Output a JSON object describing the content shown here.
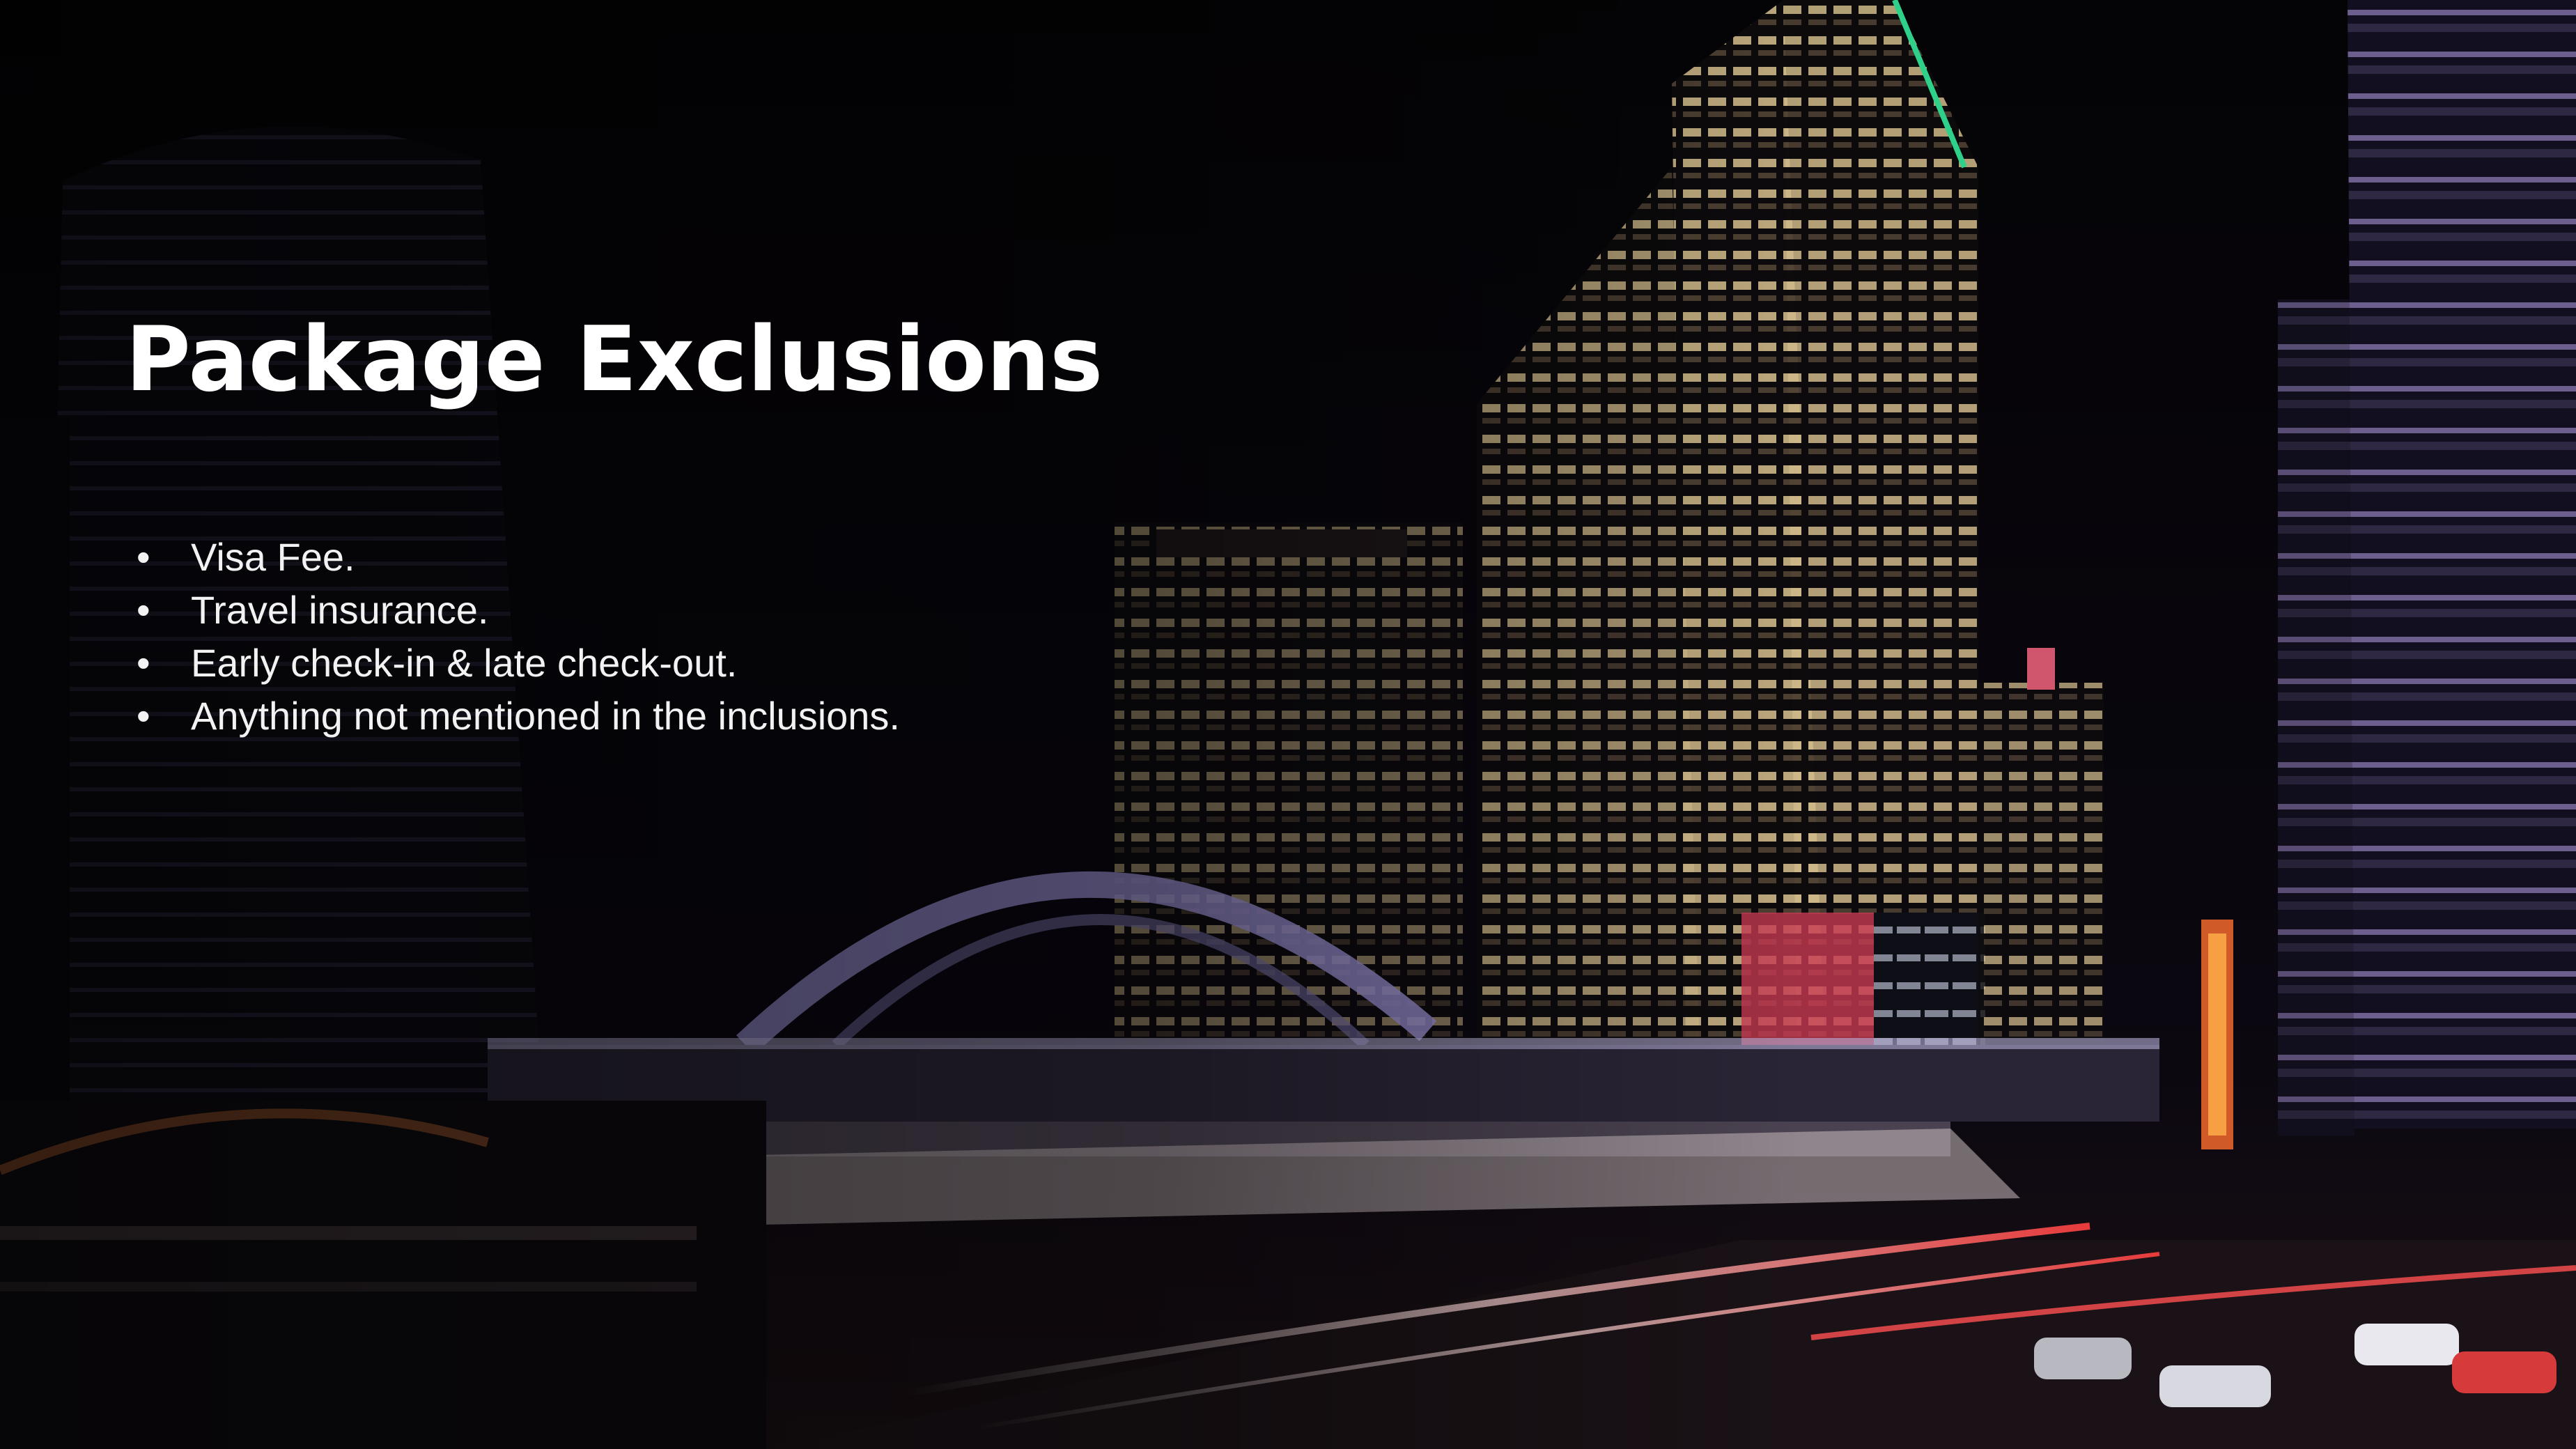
{
  "slide": {
    "title": "Package Exclusions",
    "bullet_glyph": "•",
    "exclusions": [
      "Visa Fee.",
      "Travel insurance.",
      "Early check-in & late check-out.",
      "Anything not mentioned in the inclusions."
    ],
    "background_image": "night-city-skyline-photo",
    "colors": {
      "background": "#050406",
      "text": "#ffffff"
    }
  }
}
